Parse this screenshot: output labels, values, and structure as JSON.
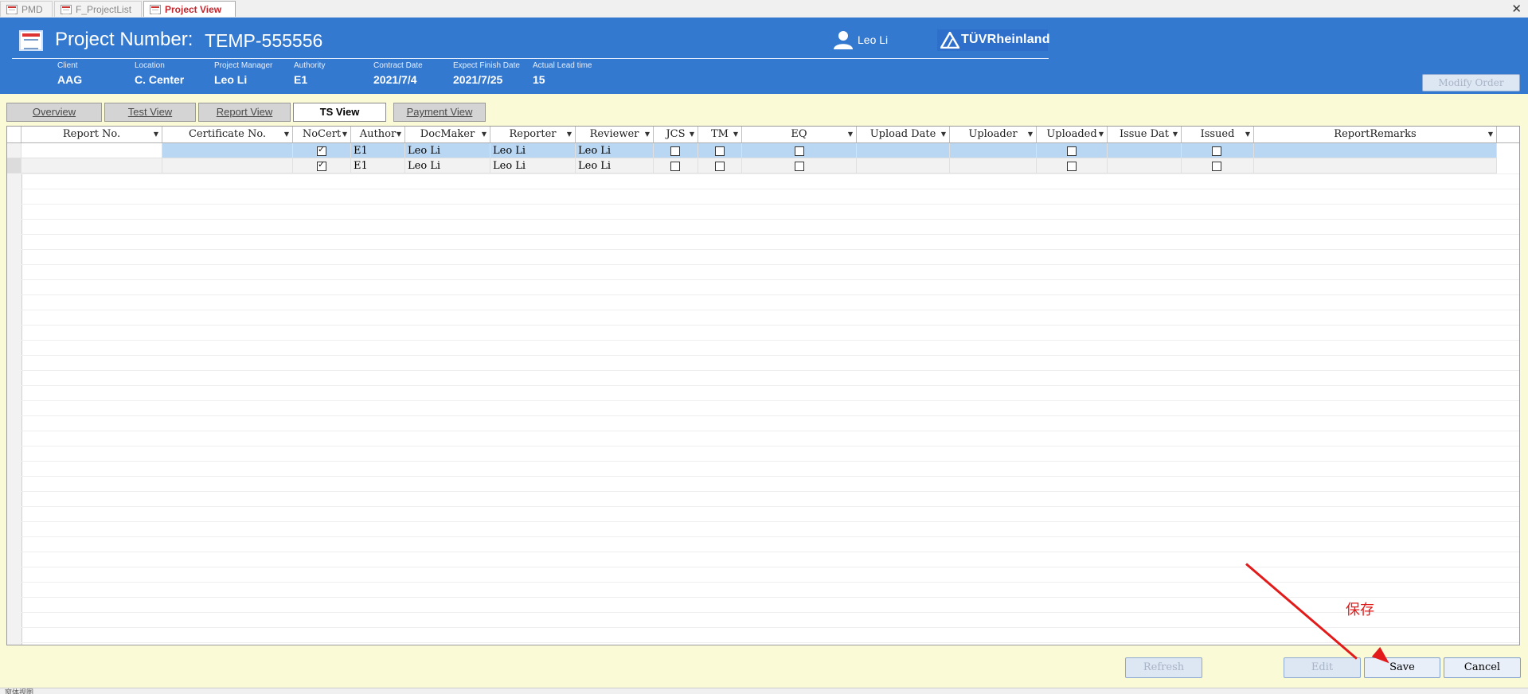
{
  "tabs": [
    {
      "label": "PMD",
      "active": false
    },
    {
      "label": "F_ProjectList",
      "active": false
    },
    {
      "label": "Project View",
      "active": true
    }
  ],
  "header": {
    "project_label": "Project Number:",
    "project_number": "TEMP-555556",
    "user": "Leo Li",
    "logo_text": "TÜVRheinland",
    "fields": [
      {
        "label": "Client",
        "value": "AAG"
      },
      {
        "label": "Location",
        "value": "C. Center"
      },
      {
        "label": "Project Manager",
        "value": "Leo Li"
      },
      {
        "label": "Authority",
        "value": "E1"
      },
      {
        "label": "Contract Date",
        "value": "2021/7/4"
      },
      {
        "label": "Expect Finish Date",
        "value": "2021/7/25"
      },
      {
        "label": "Actual Lead time",
        "value": "15"
      }
    ],
    "modify_order": "Modify Order"
  },
  "view_tabs": [
    {
      "label": "Overview",
      "active": false
    },
    {
      "label": "Test View",
      "active": false
    },
    {
      "label": "Report View",
      "active": false
    },
    {
      "label": "TS View",
      "active": true
    },
    {
      "label": "Payment View",
      "active": false
    }
  ],
  "grid": {
    "columns": [
      "Report No.",
      "Certificate No.",
      "NoCert",
      "Author",
      "DocMaker",
      "Reporter",
      "Reviewer",
      "JCS",
      "TM",
      "EQ",
      "Upload Date",
      "Uploader",
      "Uploaded",
      "Issue Dat",
      "Issued",
      "ReportRemarks"
    ],
    "rows": [
      {
        "report_no": "",
        "certificate_no": "",
        "nocert": true,
        "author": "E1",
        "docmaker": "Leo Li",
        "reporter": "Leo Li",
        "reviewer": "Leo Li",
        "jcs": false,
        "tm": false,
        "eq": false,
        "upload_date": "",
        "uploader": "",
        "uploaded": false,
        "issue_date": "",
        "issued": false,
        "remarks": ""
      },
      {
        "report_no": "",
        "certificate_no": "",
        "nocert": true,
        "author": "E1",
        "docmaker": "Leo Li",
        "reporter": "Leo Li",
        "reviewer": "Leo Li",
        "jcs": false,
        "tm": false,
        "eq": false,
        "upload_date": "",
        "uploader": "",
        "uploaded": false,
        "issue_date": "",
        "issued": false,
        "remarks": ""
      }
    ]
  },
  "buttons": {
    "refresh": "Refresh",
    "edit": "Edit",
    "save": "Save",
    "cancel": "Cancel"
  },
  "annotation": "保存",
  "status_bar": "窗体视图",
  "colors": {
    "header_bg": "#3479d0",
    "body_bg": "#fbfad7",
    "selected_row": "#b9d7f2",
    "annotation_red": "#e21a1a"
  }
}
